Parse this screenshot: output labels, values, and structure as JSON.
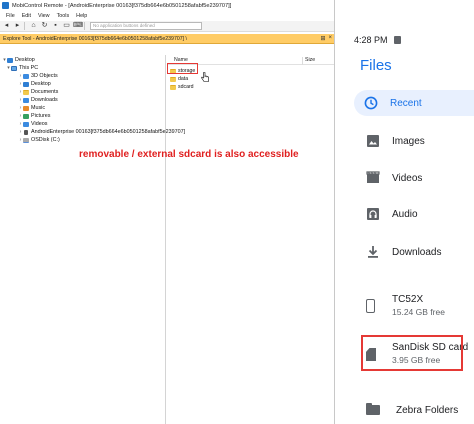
{
  "window": {
    "title": "MobiControl Remote - [AndroidEnterprise 00163[f375db664e6b0501258afabf5e239707]]",
    "menu": [
      "File",
      "Edit",
      "View",
      "Tools",
      "Help"
    ],
    "toolbar_placeholder": "No application buttons defined"
  },
  "explore_tool": {
    "title": "Explore Tool - AndroidEnterprise 00163[f375db664e6b0501258afabf5e239707] \\",
    "tree": [
      {
        "label": "Desktop",
        "icon": "desktop-icon"
      },
      {
        "label": "This PC",
        "icon": "computer-icon"
      },
      {
        "label": "3D Objects",
        "icon": "folder-icon"
      },
      {
        "label": "Desktop",
        "icon": "folder-icon"
      },
      {
        "label": "Documents",
        "icon": "documents-icon"
      },
      {
        "label": "Downloads",
        "icon": "downloads-icon"
      },
      {
        "label": "Music",
        "icon": "music-icon"
      },
      {
        "label": "Pictures",
        "icon": "pictures-icon"
      },
      {
        "label": "Videos",
        "icon": "videos-icon"
      },
      {
        "label": "AndroidEnterprise 00163[f375db664e6b0501258afabf5e239707]",
        "icon": "device-icon"
      },
      {
        "label": "OSDisk (C:)",
        "icon": "drive-icon"
      }
    ],
    "columns": {
      "name": "Name",
      "size": "Size"
    },
    "files": [
      {
        "name": "storage"
      },
      {
        "name": "data"
      },
      {
        "name": "sdcard"
      }
    ]
  },
  "annotation": "removable / external sdcard is also accessible",
  "android": {
    "time": "4:28 PM",
    "app_title": "Files",
    "nav": [
      {
        "label": "Recent",
        "icon": "clock-icon",
        "active": true
      },
      {
        "label": "Images",
        "icon": "image-icon"
      },
      {
        "label": "Videos",
        "icon": "video-icon"
      },
      {
        "label": "Audio",
        "icon": "audio-icon"
      },
      {
        "label": "Downloads",
        "icon": "download-icon"
      }
    ],
    "storage": [
      {
        "name": "TC52X",
        "free": "15.24 GB free",
        "icon": "phone-icon"
      },
      {
        "name": "SanDisk SD card",
        "free": "3.95 GB free",
        "icon": "sd-card-icon"
      }
    ],
    "folders": [
      {
        "label": "Zebra Folders",
        "icon": "folder-icon"
      }
    ]
  },
  "colors": {
    "panel_title": "#ffcc66",
    "highlight": "#e53935",
    "accent": "#1a73e8",
    "annotation": "#e02020"
  }
}
